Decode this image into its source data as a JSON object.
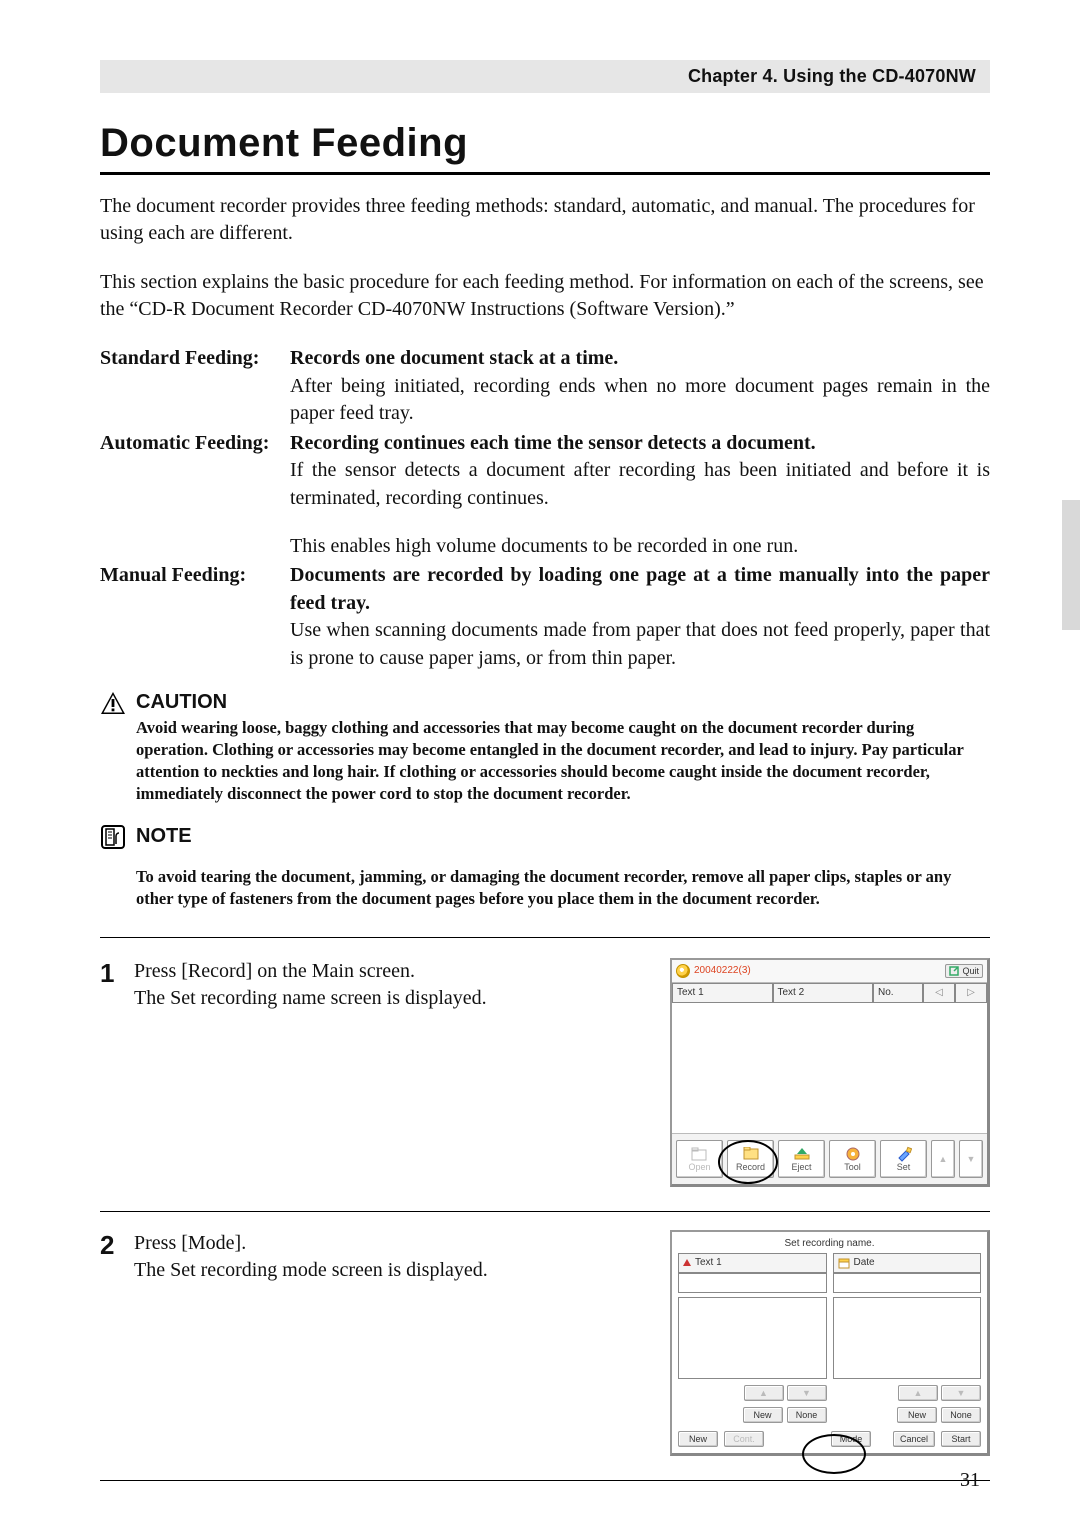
{
  "chapter": "Chapter 4. Using the CD-4070NW",
  "section_title": "Document Feeding",
  "intro1": "The document recorder provides three feeding methods: standard, automatic, and manual. The procedures for using each are different.",
  "intro2": "This section explains the basic procedure for each feeding method. For information on each of the screens, see the “CD-R Document Recorder CD-4070NW Instructions (Software Version).”",
  "defs": {
    "standard_label": "Standard Feeding:",
    "standard_bold": "Records one document stack at a time.",
    "standard_body": "After being initiated, recording ends when no more document pages remain in the paper feed tray.",
    "automatic_label": "Automatic Feeding:",
    "automatic_bold": "Recording continues each time the sensor detects a document.",
    "automatic_body1": "If the sensor detects a document after recording has been initiated and before it is terminated, recording continues.",
    "automatic_body2": "This enables high volume documents to be recorded in one run.",
    "manual_label": "Manual Feeding:",
    "manual_bold": "Documents are recorded by loading one page at a time manually into the paper feed tray.",
    "manual_body": "Use when scanning documents made from paper that does not feed properly, paper that is prone to cause paper jams, or from thin paper."
  },
  "caution": {
    "label": "CAUTION",
    "text": "Avoid wearing loose, baggy clothing and accessories that may become caught on the document recorder during operation. Clothing or accessories may become entangled in the document recorder, and lead to injury. Pay particular attention to neckties and long hair. If clothing or accessories should become caught inside the document recorder, immediately disconnect the power cord to stop the document recorder."
  },
  "note": {
    "label": "NOTE",
    "text": "To avoid tearing the document, jamming, or damaging the document recorder, remove all paper clips, staples or any other type of fasteners from the document pages before you place them in the document recorder."
  },
  "steps": {
    "s1_num": "1",
    "s1_line1": "Press [Record] on the Main screen.",
    "s1_line2": "The Set recording name screen is displayed.",
    "s2_num": "2",
    "s2_line1": "Press [Mode].",
    "s2_line2": "The Set recording mode screen is displayed."
  },
  "fig1": {
    "date": "20040222(3)",
    "quit": "Quit",
    "cols": {
      "text1": "Text 1",
      "text2": "Text 2",
      "no": "No."
    },
    "nav_prev": "◁",
    "nav_next": "▷",
    "toolbar": {
      "open": "Open",
      "record": "Record",
      "eject": "Eject",
      "tool": "Tool",
      "set": "Set"
    }
  },
  "fig2": {
    "title": "Set recording name.",
    "text1": "Text 1",
    "date": "Date",
    "nav_up": "▲",
    "nav_down": "▼",
    "new": "New",
    "none": "None",
    "cont": "Cont.",
    "mode": "Mode",
    "cancel": "Cancel",
    "start": "Start"
  },
  "page_number": "31"
}
